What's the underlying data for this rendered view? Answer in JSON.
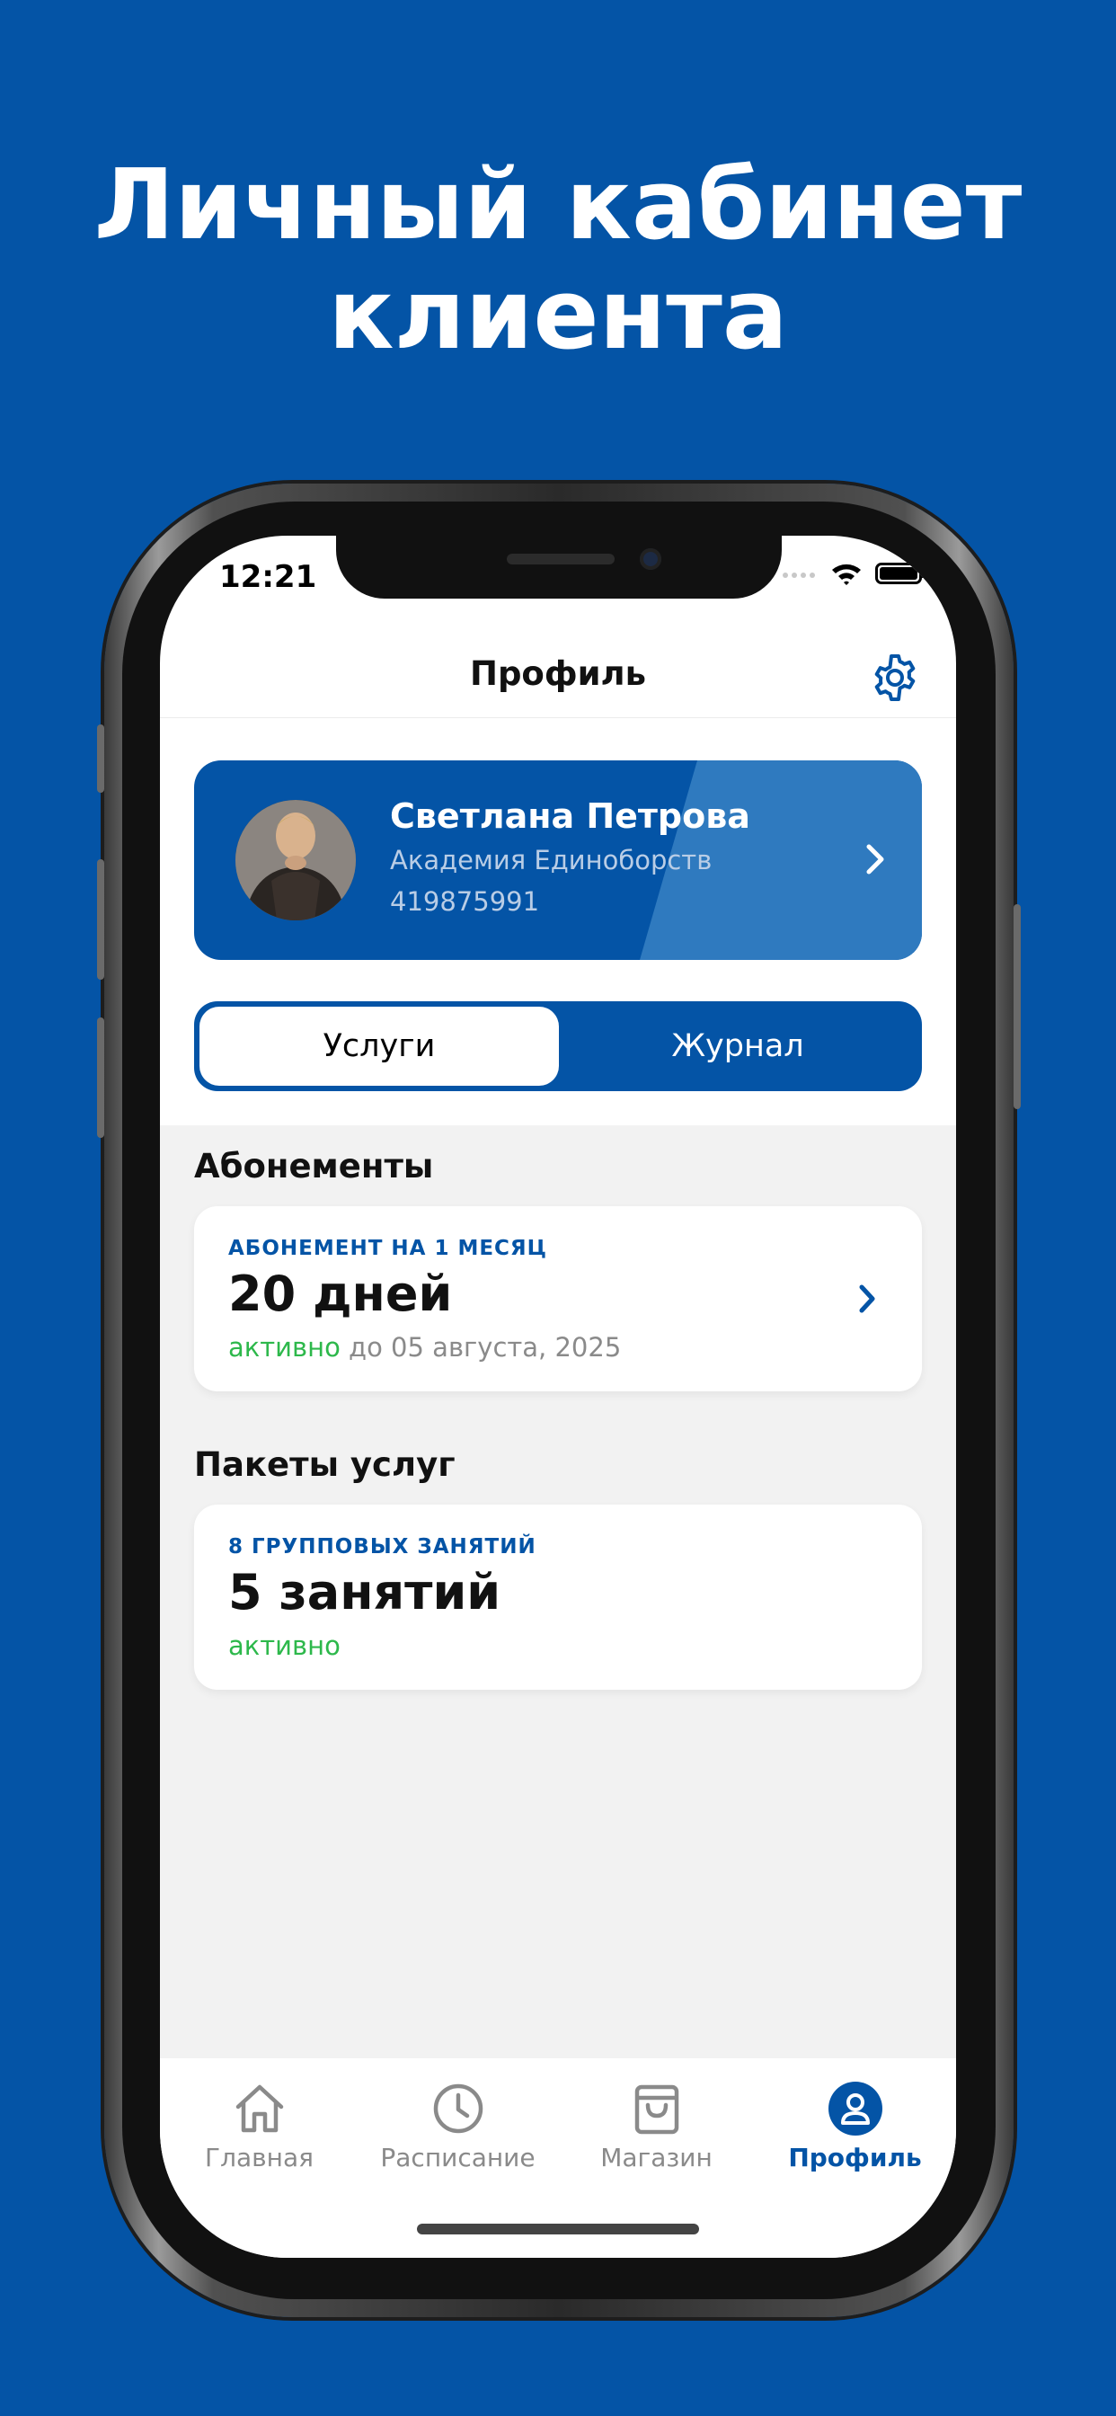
{
  "headline": {
    "line1": "Личный кабинет",
    "line2": "клиента"
  },
  "status_bar": {
    "time": "12:21"
  },
  "nav": {
    "title": "Профиль"
  },
  "profile": {
    "name": "Светлана Петрова",
    "organization": "Академия Единоборств",
    "id": "419875991"
  },
  "segments": {
    "services": "Услуги",
    "journal": "Журнал",
    "selected": "Услуги"
  },
  "subscriptions": {
    "title": "Абонементы",
    "items": [
      {
        "caption": "АБОНЕМЕНТ НА 1 МЕСЯЦ",
        "value": "20 дней",
        "status": "активно",
        "until": "до 05 августа, 2025"
      }
    ]
  },
  "packages": {
    "title": "Пакеты услуг",
    "items": [
      {
        "caption": "8 ГРУППОВЫХ ЗАНЯТИЙ",
        "value": "5 занятий",
        "status": "активно"
      }
    ]
  },
  "tabbar": {
    "items": [
      {
        "label": "Главная",
        "icon": "home-icon"
      },
      {
        "label": "Расписание",
        "icon": "clock-icon"
      },
      {
        "label": "Магазин",
        "icon": "shopping-bag-icon"
      },
      {
        "label": "Профиль",
        "icon": "profile-icon"
      }
    ],
    "active": "Профиль"
  },
  "colors": {
    "brand": "#0454A6",
    "active_green": "#2DB84B",
    "muted": "#8a8a8a"
  }
}
